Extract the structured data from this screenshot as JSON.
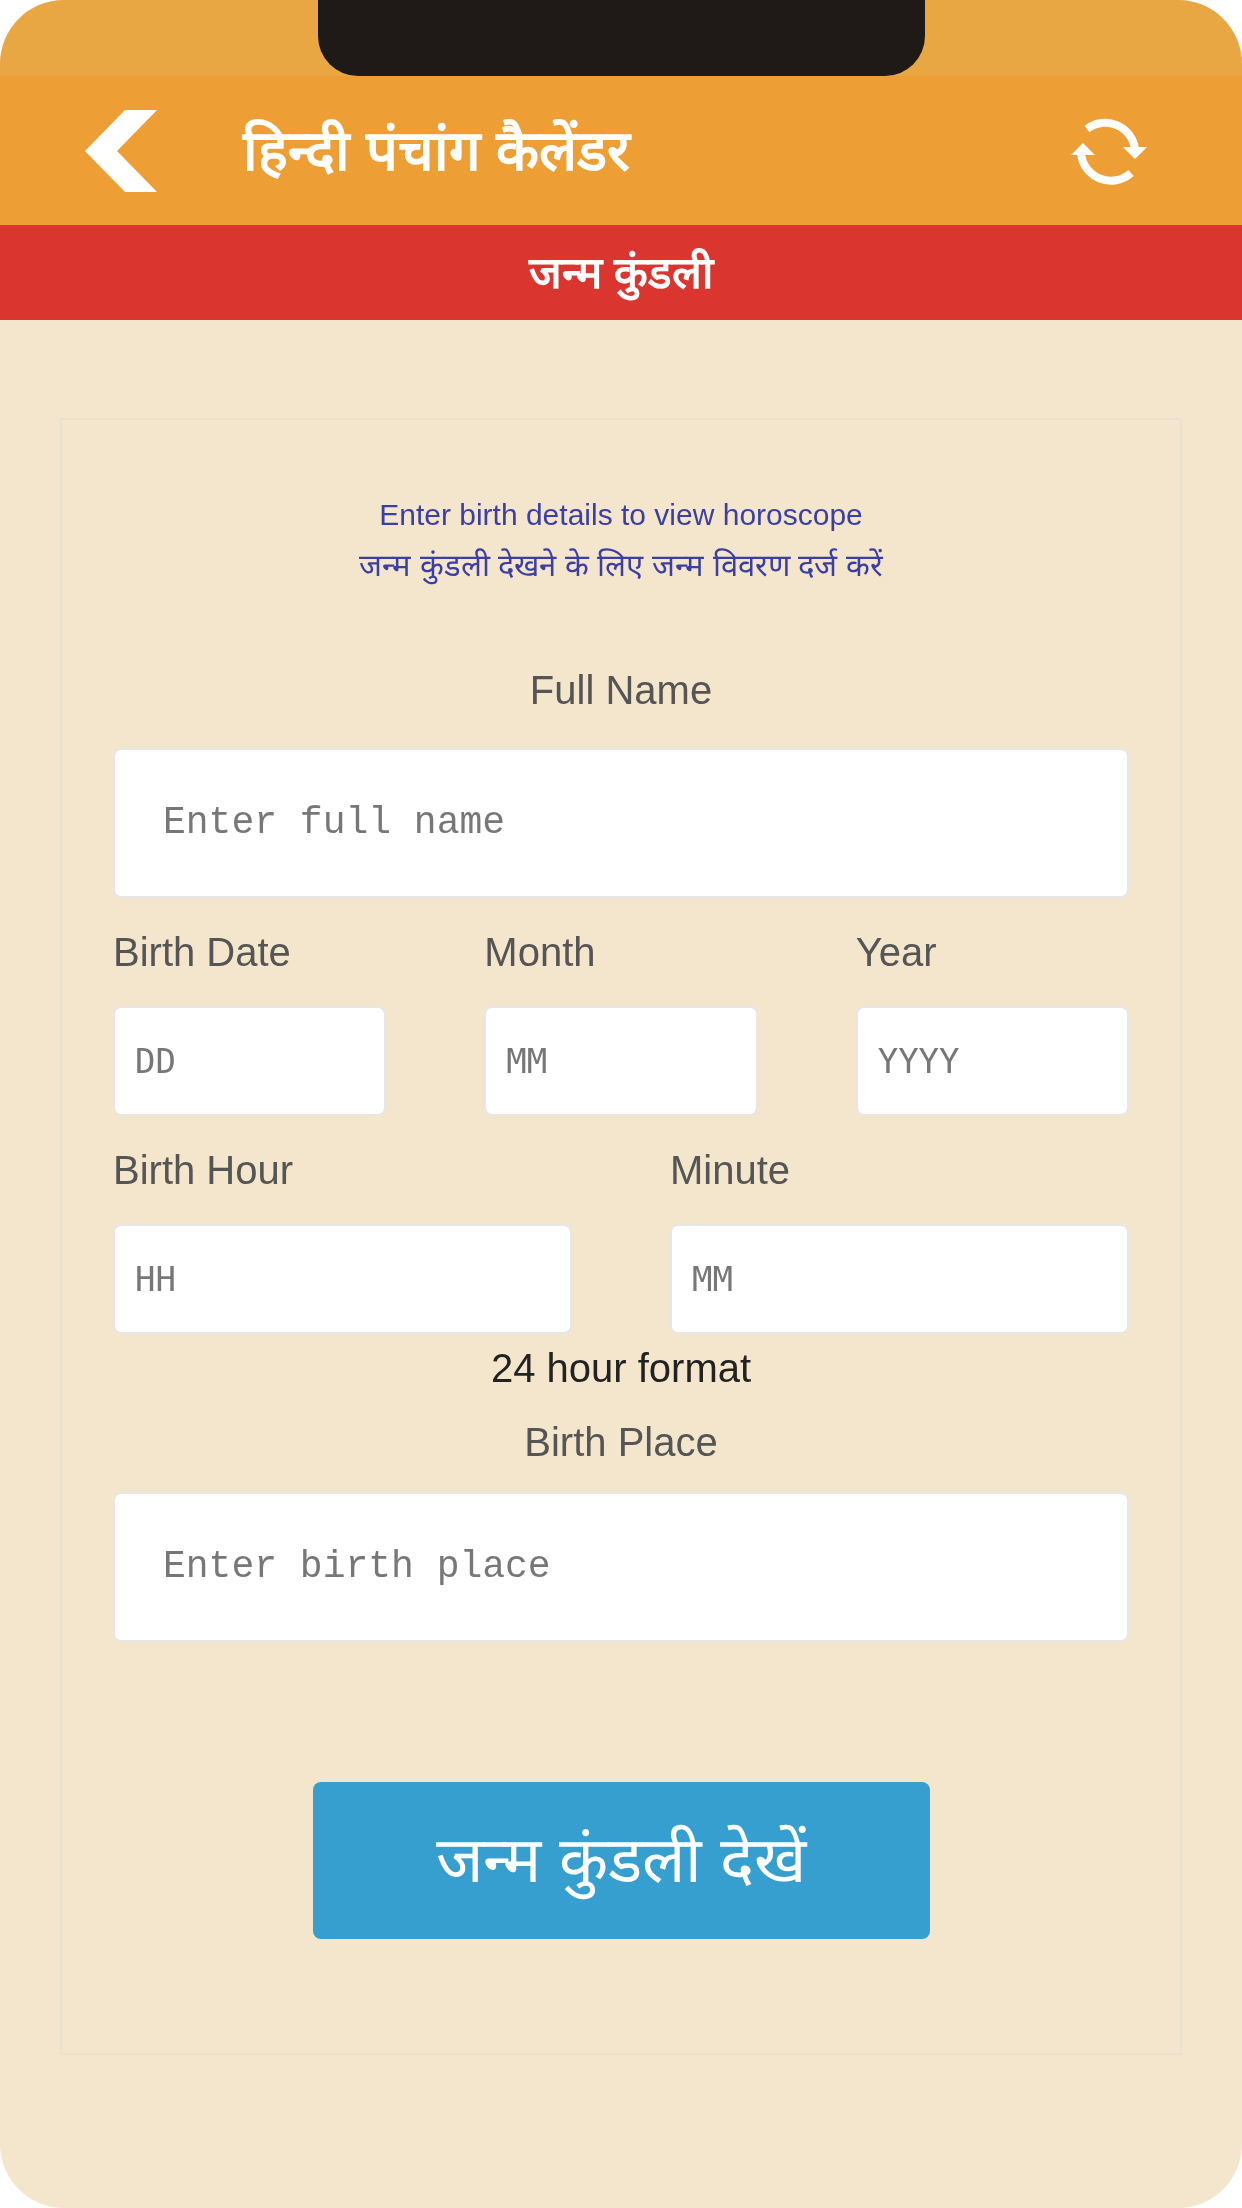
{
  "header": {
    "title": "हिन्दी पंचांग कैलेंडर"
  },
  "section_bar": {
    "title": "जन्म कुंडली"
  },
  "form": {
    "intro_en": "Enter birth details to view horoscope",
    "intro_hi": "जन्म कुंडली देखने के लिए जन्म विवरण दर्ज करें",
    "full_name": {
      "label": "Full Name",
      "placeholder": "Enter full name"
    },
    "date_fields": [
      {
        "label": "Birth Date",
        "placeholder": "DD"
      },
      {
        "label": "Month",
        "placeholder": "MM"
      },
      {
        "label": "Year",
        "placeholder": "YYYY"
      }
    ],
    "time_fields": [
      {
        "label": "Birth Hour",
        "placeholder": "HH"
      },
      {
        "label": "Minute",
        "placeholder": "MM"
      }
    ],
    "time_note": "24 hour format",
    "birth_place": {
      "label": "Birth Place",
      "placeholder": "Enter birth place"
    },
    "submit": "जन्म कुंडली देखें"
  }
}
